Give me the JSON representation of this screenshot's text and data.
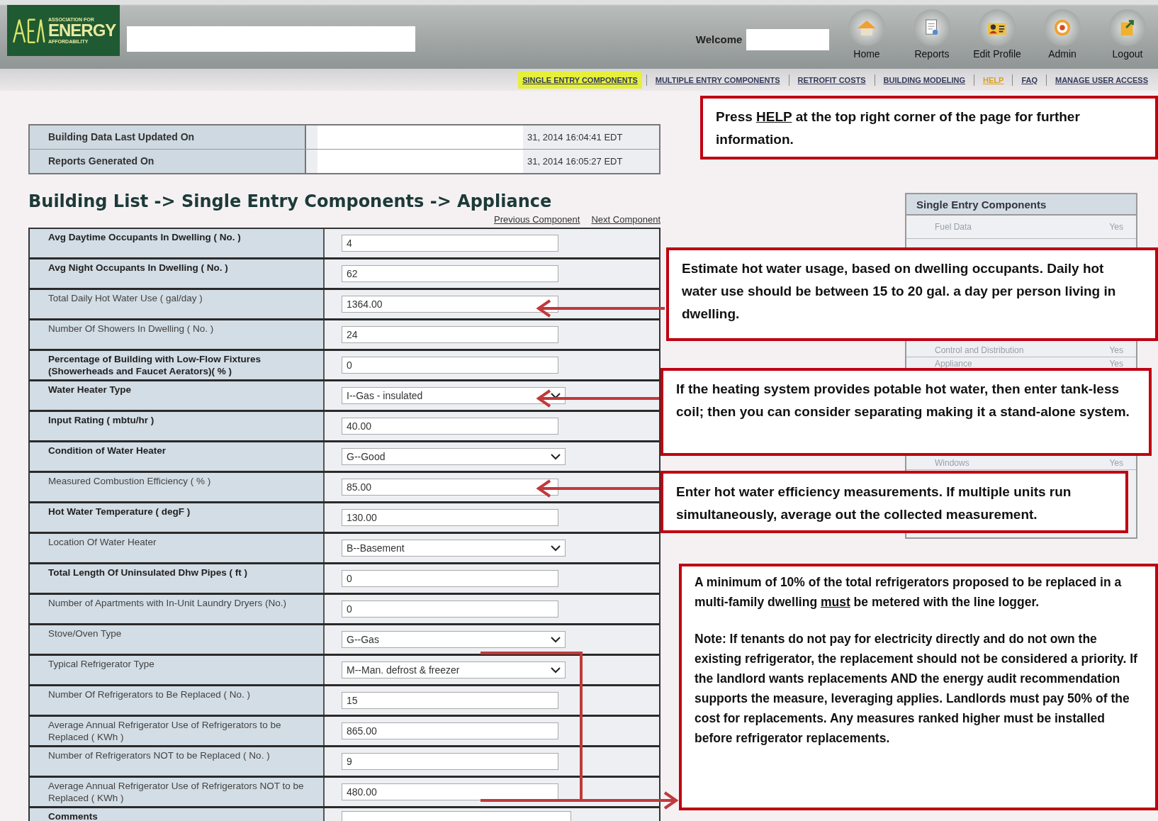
{
  "header": {
    "logo": {
      "line1": "ASSOCIATION FOR",
      "line2": "ENERGY",
      "line3": "AFFORDABILITY"
    },
    "welcome": "Welcome",
    "nav_icons": [
      {
        "kind": "home",
        "label": "Home"
      },
      {
        "kind": "reports",
        "label": "Reports"
      },
      {
        "kind": "profile",
        "label": "Edit Profile"
      },
      {
        "kind": "admin",
        "label": "Admin"
      },
      {
        "kind": "logout",
        "label": "Logout"
      }
    ]
  },
  "menu": [
    {
      "label": "SINGLE ENTRY COMPONENTS",
      "selected": true,
      "accent": false
    },
    {
      "label": "MULTIPLE ENTRY COMPONENTS",
      "selected": false,
      "accent": false
    },
    {
      "label": "RETROFIT COSTS",
      "selected": false,
      "accent": false
    },
    {
      "label": "BUILDING MODELING",
      "selected": false,
      "accent": false
    },
    {
      "label": "HELP",
      "selected": false,
      "accent": true
    },
    {
      "label": "FAQ",
      "selected": false,
      "accent": false
    },
    {
      "label": "MANAGE USER ACCESS",
      "selected": false,
      "accent": false
    }
  ],
  "info_table": [
    {
      "label": "Building Data Last Updated On",
      "value": "31, 2014 16:04:41 EDT"
    },
    {
      "label": "Reports Generated On",
      "value": "31, 2014 16:05:27 EDT"
    }
  ],
  "breadcrumb": "Building List -> Single Entry Components -> Appliance",
  "component_links": [
    "Previous Component",
    "Next Component"
  ],
  "form_rows": [
    {
      "label": "Avg Daytime Occupants In Dwelling ( No. )",
      "bold": true,
      "kind": "input",
      "value": "4"
    },
    {
      "label": "Avg Night Occupants In Dwelling ( No. )",
      "bold": true,
      "kind": "input",
      "value": "62"
    },
    {
      "label": "Total Daily Hot Water Use ( gal/day )",
      "bold": false,
      "kind": "input",
      "value": "1364.00"
    },
    {
      "label": "Number Of Showers In Dwelling ( No. )",
      "bold": false,
      "kind": "input",
      "value": "24"
    },
    {
      "label": "Percentage of Building with Low-Flow Fixtures (Showerheads and Faucet Aerators)( % )",
      "bold": true,
      "kind": "input",
      "value": "0"
    },
    {
      "label": "Water Heater Type",
      "bold": true,
      "kind": "select",
      "value": "I--Gas - insulated"
    },
    {
      "label": "Input Rating ( mbtu/hr )",
      "bold": true,
      "kind": "input",
      "value": "40.00"
    },
    {
      "label": "Condition of Water Heater",
      "bold": true,
      "kind": "select",
      "value": "G--Good"
    },
    {
      "label": "Measured Combustion Efficiency ( % )",
      "bold": false,
      "kind": "input",
      "value": "85.00"
    },
    {
      "label": "Hot Water Temperature ( degF )",
      "bold": true,
      "kind": "input",
      "value": "130.00"
    },
    {
      "label": "Location Of Water Heater",
      "bold": false,
      "kind": "select",
      "value": "B--Basement"
    },
    {
      "label": "Total Length Of Uninsulated Dhw Pipes ( ft )",
      "bold": true,
      "kind": "input",
      "value": "0"
    },
    {
      "label": "Number of Apartments with In-Unit Laundry Dryers (No.)",
      "bold": false,
      "kind": "input",
      "value": "0"
    },
    {
      "label": "Stove/Oven Type",
      "bold": false,
      "kind": "select",
      "value": "G--Gas"
    },
    {
      "label": "Typical Refrigerator Type",
      "bold": false,
      "kind": "select",
      "value": "M--Man. defrost & freezer"
    },
    {
      "label": "Number Of Refrigerators to Be Replaced ( No. )",
      "bold": false,
      "kind": "input",
      "value": "15"
    },
    {
      "label": "Average Annual Refrigerator Use of Refrigerators to be Replaced ( KWh )",
      "bold": false,
      "kind": "input",
      "value": "865.00"
    },
    {
      "label": "Number of Refrigerators NOT to be Replaced ( No. )",
      "bold": false,
      "kind": "input",
      "value": "9"
    },
    {
      "label": "Average Annual Refrigerator Use of Refrigerators NOT to be Replaced ( KWh )",
      "bold": false,
      "kind": "input",
      "value": "480.00"
    },
    {
      "label": "Comments",
      "bold": true,
      "kind": "textarea"
    }
  ],
  "sidebar": {
    "title": "Single Entry Components",
    "items": [
      {
        "name": "Fuel Data",
        "status": "Yes"
      },
      {
        "name": "Control and Distribution",
        "status": "Yes"
      },
      {
        "name": "Appliance",
        "status": "Yes"
      },
      {
        "name": "Windows",
        "status": "Yes"
      }
    ]
  },
  "callouts": [
    {
      "paragraphs": [
        [
          {
            "text": "Press ",
            "underline": false
          },
          {
            "text": "HELP",
            "underline": true
          },
          {
            "text": " at the top right corner of the page for further information.",
            "underline": false
          }
        ]
      ]
    },
    {
      "paragraphs": [
        [
          {
            "text": "Estimate hot water usage, based on dwelling occupants. Daily hot water use should be between 15 to 20 gal. a day per person living in dwelling.",
            "underline": false
          }
        ]
      ]
    },
    {
      "paragraphs": [
        [
          {
            "text": "If the heating system provides potable hot water, then enter tank-less coil; then you can consider separating making it a stand-alone system.",
            "underline": false
          }
        ]
      ]
    },
    {
      "paragraphs": [
        [
          {
            "text": "Enter hot water efficiency measurements.  If multiple units run simultaneously, average out the collected measurement.",
            "underline": false
          }
        ]
      ]
    },
    {
      "paragraphs": [
        [
          {
            "text": "A minimum of 10% of the total refrigerators proposed to be replaced in a multi-family dwelling ",
            "underline": false
          },
          {
            "text": "must",
            "underline": true
          },
          {
            "text": " be metered with the line logger.",
            "underline": false
          }
        ],
        [
          {
            "text": "Note: If tenants do not pay for electricity directly and do not own the existing refrigerator, the replacement should not be considered a priority. If the landlord wants replacements AND the energy audit recommendation supports the measure, leveraging applies. Landlords must pay 50% of the cost for replacements. Any measures ranked higher must be installed before refrigerator replacements.",
            "underline": false
          }
        ]
      ]
    }
  ]
}
